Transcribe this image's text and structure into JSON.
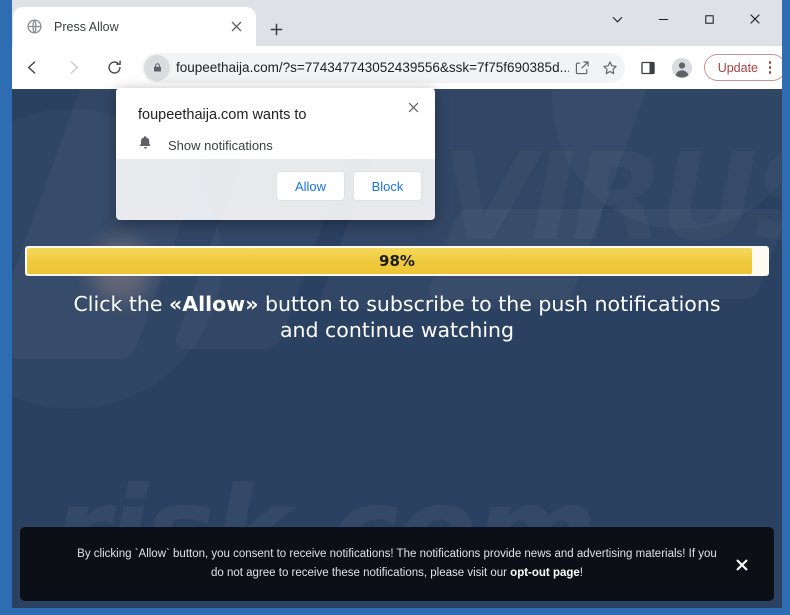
{
  "window": {
    "controls": {
      "chevron_label": "⌄",
      "minimize_label": "─",
      "maximize_label": "□",
      "close_label": "✕"
    }
  },
  "tabstrip": {
    "tab": {
      "title": "Press Allow",
      "favicon_name": "globe-icon",
      "close_label": "✕"
    },
    "new_tab_label": "+"
  },
  "toolbar": {
    "back_name": "back-arrow-icon",
    "forward_name": "forward-arrow-icon",
    "reload_name": "reload-icon",
    "url": "foupeethaija.com/?s=774347743052439556&ssk=7f75f690385d...",
    "lock_name": "lock-icon",
    "share_name": "share-icon",
    "bookmark_name": "star-icon",
    "side_panel_name": "side-panel-icon",
    "profile_name": "profile-avatar-icon",
    "update_label": "Update",
    "update_accent": "#a8423c"
  },
  "permission_dialog": {
    "title": "foupeethaija.com wants to",
    "permission_label": "Show notifications",
    "permission_icon_name": "bell-icon",
    "close_label": "✕",
    "allow_label": "Allow",
    "block_label": "Block",
    "link_color": "#1a73e8"
  },
  "page": {
    "background_color": "#2b4161",
    "watermark_bottom": "risk.com",
    "watermark_top": "VIRUS",
    "progress": {
      "percent": 98,
      "percent_label": "98%",
      "fill_color": "#efc93c",
      "track_color": "#fdfaf2"
    },
    "headline_prefix": "Click the ",
    "headline_emphasis": "«Allow»",
    "headline_suffix": " button to subscribe to the push notifications and continue watching"
  },
  "consent_banner": {
    "background_color": "#0c1016",
    "text_part1": "By clicking `Allow` button, you consent to receive notifications! The notifications provide news and advertising materials! If you do not agree to receive these notifications, please visit our ",
    "link_label": "opt-out page",
    "text_part2": "!",
    "close_label": "✕"
  }
}
